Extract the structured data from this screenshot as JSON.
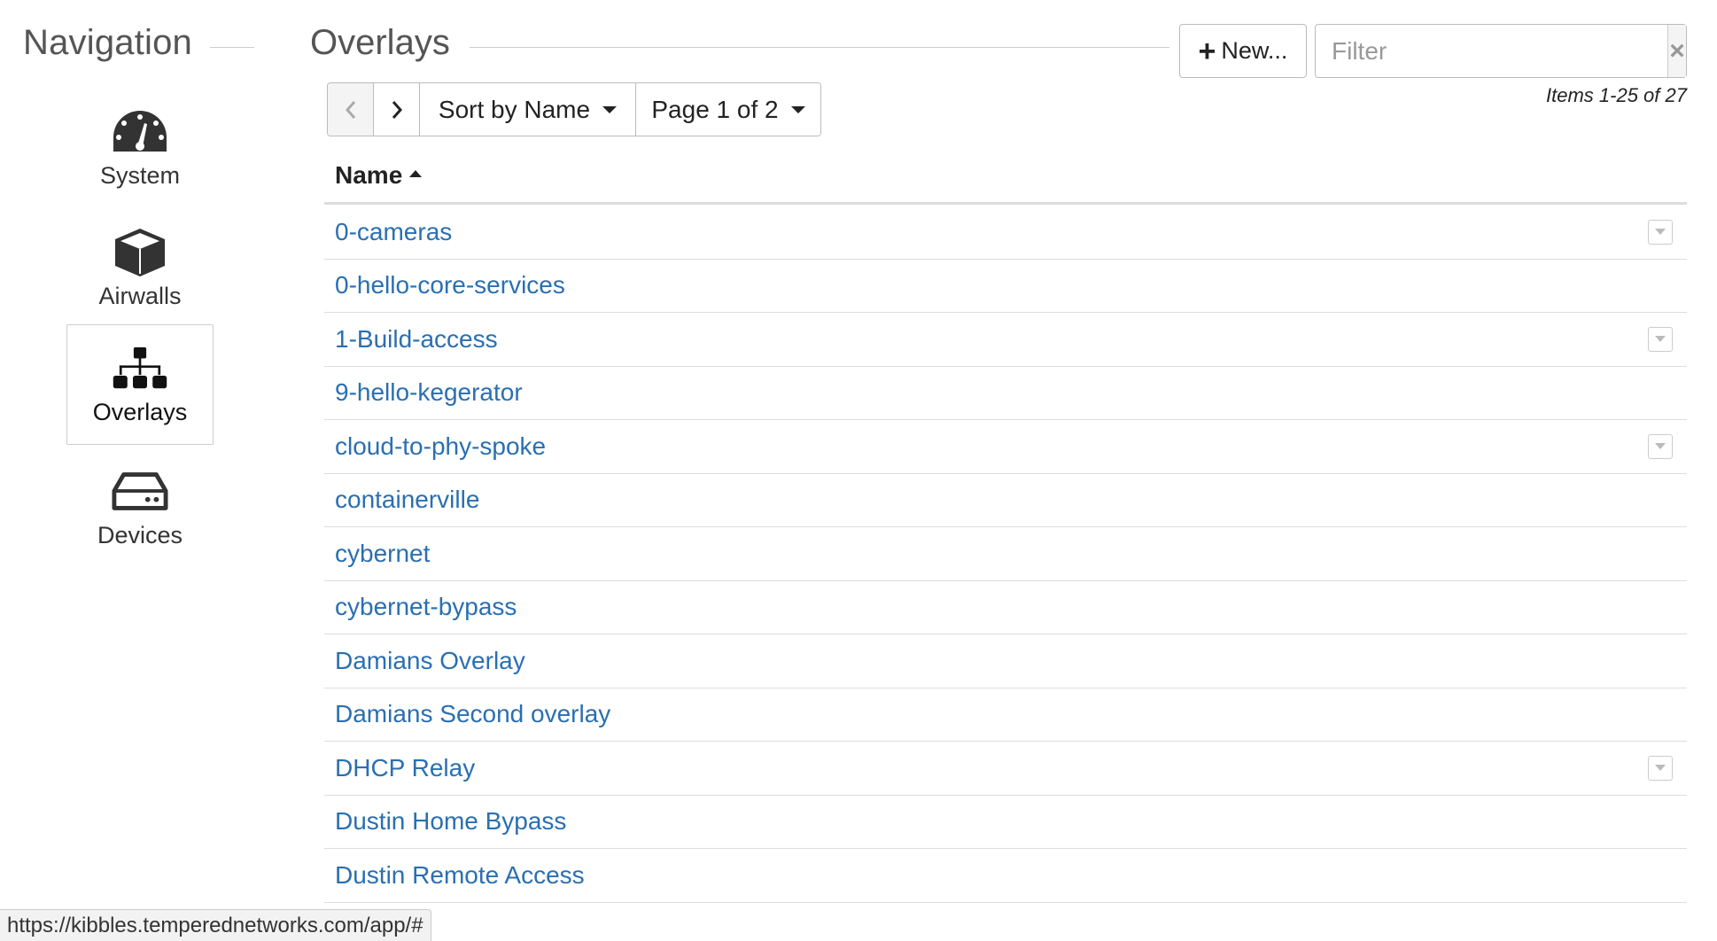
{
  "navigation": {
    "title": "Navigation",
    "items": [
      {
        "label": "System",
        "icon": "dashboard-gauge-icon",
        "active": false
      },
      {
        "label": "Airwalls",
        "icon": "cube-icon",
        "active": false
      },
      {
        "label": "Overlays",
        "icon": "network-tree-icon",
        "active": true
      },
      {
        "label": "Devices",
        "icon": "hard-drive-icon",
        "active": false
      }
    ]
  },
  "main": {
    "title": "Overlays",
    "new_button_label": "New...",
    "filter_placeholder": "Filter",
    "items_count": "Items 1-25 of 27",
    "sort_label": "Sort by Name",
    "page_label": "Page 1 of 2",
    "column_header": "Name",
    "rows": [
      {
        "name": "0-cameras",
        "has_menu": true
      },
      {
        "name": "0-hello-core-services",
        "has_menu": false
      },
      {
        "name": "1-Build-access",
        "has_menu": true
      },
      {
        "name": "9-hello-kegerator",
        "has_menu": false
      },
      {
        "name": "cloud-to-phy-spoke",
        "has_menu": true
      },
      {
        "name": "containerville",
        "has_menu": false
      },
      {
        "name": "cybernet",
        "has_menu": false
      },
      {
        "name": "cybernet-bypass",
        "has_menu": false
      },
      {
        "name": "Damians Overlay",
        "has_menu": false
      },
      {
        "name": "Damians Second overlay",
        "has_menu": false
      },
      {
        "name": "DHCP Relay",
        "has_menu": true
      },
      {
        "name": "Dustin Home Bypass",
        "has_menu": false
      },
      {
        "name": "Dustin Remote Access",
        "has_menu": false
      }
    ]
  },
  "status_bar": {
    "url": "https://kibbles.temperednetworks.com/app/#"
  },
  "colors": {
    "link": "#2a6fb1",
    "heading": "#555555",
    "icon": "#333333"
  }
}
